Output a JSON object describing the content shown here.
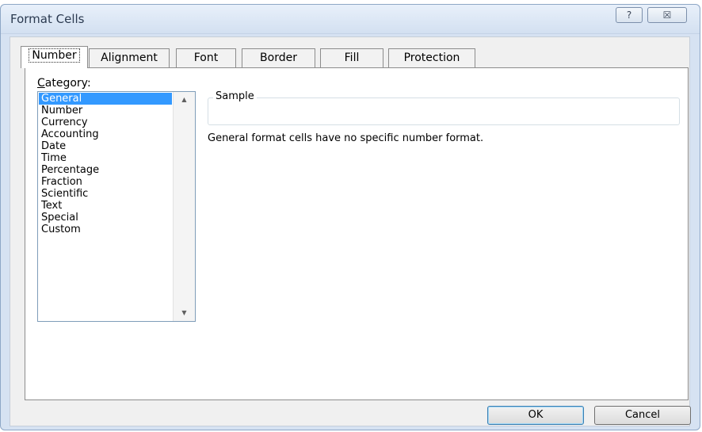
{
  "window": {
    "title": "Format Cells",
    "help_icon": "help-icon",
    "help_glyph": "?",
    "close_icon": "close-icon",
    "close_glyph": "☒"
  },
  "tabs": [
    {
      "label": "Number",
      "active": true
    },
    {
      "label": "Alignment",
      "active": false
    },
    {
      "label": "Font",
      "active": false
    },
    {
      "label": "Border",
      "active": false
    },
    {
      "label": "Fill",
      "active": false
    },
    {
      "label": "Protection",
      "active": false
    }
  ],
  "category": {
    "label_prefix": "",
    "label_mnemonic": "C",
    "label_rest": "ategory:",
    "items": [
      "General",
      "Number",
      "Currency",
      "Accounting",
      "Date",
      "Time",
      "Percentage",
      "Fraction",
      "Scientific",
      "Text",
      "Special",
      "Custom"
    ],
    "selected": "General"
  },
  "scroll": {
    "up_icon": "scroll-up-arrow-icon",
    "up_glyph": "▲",
    "down_icon": "scroll-down-arrow-icon",
    "down_glyph": "▼"
  },
  "sample": {
    "legend": "Sample",
    "value": ""
  },
  "description": "General format cells have no specific number format.",
  "buttons": {
    "ok": "OK",
    "cancel": "Cancel"
  },
  "colors": {
    "selection": "#3399ff",
    "dialog_frame": "#d6e2f2",
    "panel": "#ffffff"
  }
}
